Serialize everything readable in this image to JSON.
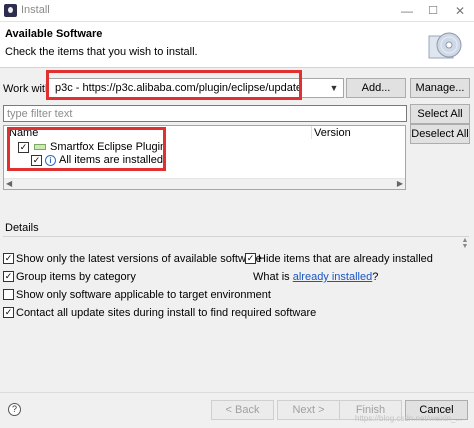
{
  "window": {
    "title": "Install",
    "minimize": "—",
    "maximize": "☐",
    "close": "✕"
  },
  "header": {
    "title": "Available Software",
    "description": "Check the items that you wish to install."
  },
  "workwith": {
    "label": "Work with:",
    "value": "p3c - https://p3c.alibaba.com/plugin/eclipse/update",
    "add_label": "Add...",
    "manage_label": "Manage..."
  },
  "filter": {
    "placeholder": "type filter text",
    "select_all": "Select All",
    "deselect_all": "Deselect All"
  },
  "tree": {
    "columns": [
      "Name",
      "Version"
    ],
    "items": [
      {
        "label": "Smartfox Eclipse Plugin",
        "checked": "✓"
      },
      {
        "label": "All items are installed",
        "checked": "✓"
      }
    ]
  },
  "details": {
    "label": "Details"
  },
  "options": [
    {
      "label": "Show only the latest versions of available software",
      "checked": "✓"
    },
    {
      "label": "Hide items that are already installed",
      "checked": "✓"
    },
    {
      "label": "Group items by category",
      "checked": "✓"
    },
    {
      "label": "Show only software applicable to target environment",
      "checked": ""
    },
    {
      "label": "Contact all update sites during install to find required software",
      "checked": "✓"
    }
  ],
  "already_installed": {
    "prefix": "What is ",
    "link": "already installed",
    "suffix": "?"
  },
  "buttons": {
    "back": "< Back",
    "next": "Next >",
    "finish": "Finish",
    "cancel": "Cancel"
  },
  "watermark": "https://blog.csdn.net/weixin_..."
}
